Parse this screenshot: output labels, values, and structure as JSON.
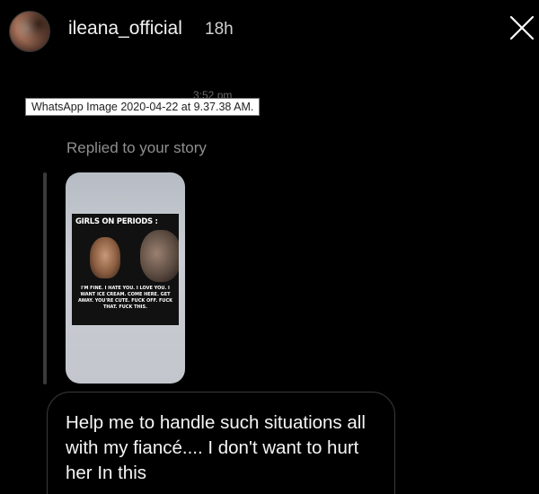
{
  "header": {
    "username": "ileana_official",
    "time": "18h",
    "avatar_icon": "user-avatar",
    "close_icon": "close-icon"
  },
  "tooltip": {
    "text": "WhatsApp Image 2020-04-22 at 9.37.38 AM."
  },
  "message": {
    "behind_time": "3:52 pm",
    "replied_label": "Replied to your story",
    "story": {
      "meme_title": "GIRLS ON PERIODS :",
      "meme_caption": "I'M FINE. I HATE YOU. I LOVE YOU. I WANT ICE CREAM. COME HERE. GET AWAY. YOU'RE CUTE. FUCK OFF. FUCK THAT. FUCK THIS."
    },
    "text": "Help me to handle such situations all with my fiancé.... I don't want to hurt her In this"
  },
  "colors": {
    "background": "#000000",
    "text": "#f5f5f5",
    "muted": "#8f8f8f"
  }
}
